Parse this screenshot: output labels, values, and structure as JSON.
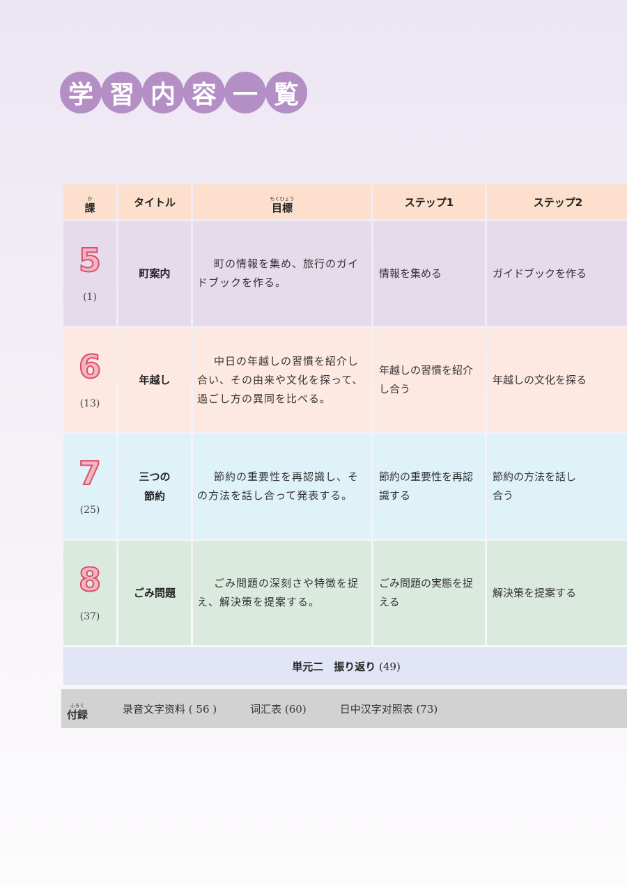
{
  "title_chars": [
    "学",
    "習",
    "内",
    "容",
    "一",
    "覧"
  ],
  "header": {
    "lesson": "課",
    "lesson_ruby": "か",
    "title": "タイトル",
    "goal": "目標",
    "goal_ruby": "もくひょう",
    "step1": "ステップ1",
    "step2": "ステップ2"
  },
  "lessons": [
    {
      "num": "5",
      "page": "(1)",
      "title": "町案内",
      "goal": "町の情報を集め、旅行のガイドブックを作る。",
      "step1": "情報を集める",
      "step2": "ガイドブックを作る"
    },
    {
      "num": "6",
      "page": "(13)",
      "title": "年越し",
      "goal": "中日の年越しの習慣を紹介し合い、その由来や文化を探って、過ごし方の異同を比べる。",
      "step1": "年越しの習慣を紹介し合う",
      "step2": "年越しの文化を探る"
    },
    {
      "num": "7",
      "page": "(25)",
      "title": "三つの節約",
      "goal": "節約の重要性を再認識し、その方法を話し合って発表する。",
      "step1": "節約の重要性を再認識する",
      "step2": "節約の方法を話し合う"
    },
    {
      "num": "8",
      "page": "(37)",
      "title": "ごみ問題",
      "goal": "ごみ問題の深刻さや特徴を捉え、解決策を提案する。",
      "step1": "ごみ問題の実態を捉える",
      "step2": "解決策を提案する"
    }
  ],
  "review": {
    "label": "単元二　振り返り",
    "page": "(49)"
  },
  "appendix": {
    "label": "付録",
    "label_ruby": "ふろく",
    "items": [
      "录音文字资料 ( 56 )",
      "词汇表 (60)",
      "日中汉字对照表 (73)"
    ]
  }
}
